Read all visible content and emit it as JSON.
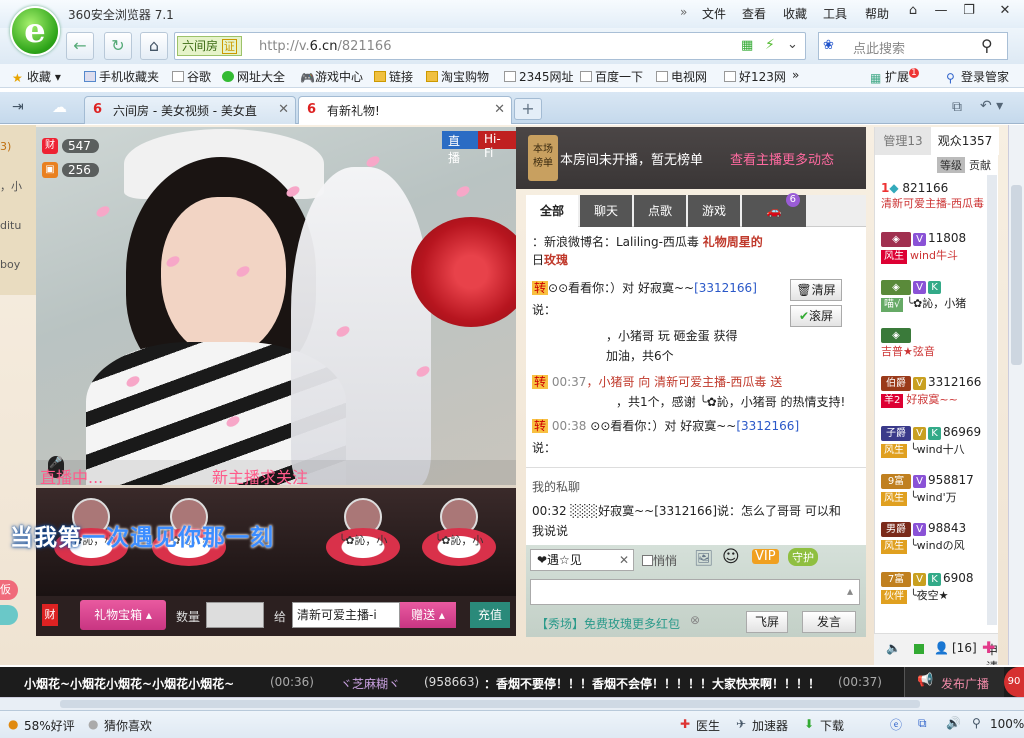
{
  "browser": {
    "title": "360安全浏览器 7.1",
    "menu": [
      "文件",
      "查看",
      "收藏",
      "工具",
      "帮助"
    ],
    "site_tag": "六间房",
    "cert_label": "证",
    "url_prefix": "http://v.",
    "url_domain": "6.cn",
    "url_path": "/821166",
    "search_placeholder": "点此搜索",
    "logo_letter": "e"
  },
  "bookmarks": {
    "items": [
      "收藏",
      "手机收藏夹",
      "谷歌",
      "网址大全",
      "游戏中心",
      "链接",
      "淘宝购物",
      "2345网址",
      "百度一下",
      "电视网",
      "好123网"
    ],
    "more": "»",
    "extend": "扩展",
    "extend_badge": "1",
    "login": "登录管家"
  },
  "tabs": [
    {
      "label": "六间房 - 美女视频 - 美女直",
      "active": false
    },
    {
      "label": "有新礼物!",
      "active": true
    }
  ],
  "video": {
    "live_label": "直播",
    "hifi_label": "Hi-Fi",
    "wealth_icon": "财",
    "wealth_value": "547",
    "gift_value": "256",
    "live_status": "直播中...",
    "new_host": "新主播求关注",
    "karaoke_pre": "当我第",
    "karaoke_hl": "一次遇见你那一刻",
    "gifts": [
      "╰✿訫，小",
      "╰✿訫，小",
      "╰✿訫，小",
      "╰✿訫，小"
    ]
  },
  "giftbar": {
    "wealth_icon": "财",
    "box_label": "礼物宝箱",
    "qty_label": "数量",
    "to_label": "给",
    "recipient": "清新可爱主播-i",
    "give_button": "赠送",
    "recharge_button": "充值"
  },
  "left_panel": {
    "lines": [
      "3)",
      "，小",
      "ditu",
      "boy"
    ],
    "bottom": [
      "仮"
    ]
  },
  "notice": {
    "badge_top": "本场",
    "badge_bottom": "榜单",
    "text": "本房间未开播，暂无榜单",
    "link": "查看主播更多动态"
  },
  "chat_tabs": [
    "全部",
    "聊天",
    "点歌",
    "游戏"
  ],
  "chat_tab_badge": "6",
  "chat": {
    "lines": [
      {
        "prefix": "",
        "user": "",
        "text": "：新浪微博名：Laliling-西瓜毒",
        "extra": "礼物周星的"
      },
      {
        "prefix": "日",
        "user": "",
        "text": "玫瑰",
        "extra": ""
      },
      {
        "prefix": "转",
        "user": "",
        "text": "⊙⊙看看你：）对 好寂寞~~",
        "extra": "[3312166]"
      },
      {
        "prefix": "说：",
        "user": "",
        "text": "",
        "extra": ""
      },
      {
        "prefix": "",
        "user": "",
        "text": "，小猪哥 玩 砸金蛋 获得",
        "extra": ""
      },
      {
        "prefix": "",
        "user": "",
        "text": "加油，共6个",
        "extra": ""
      },
      {
        "prefix": "转",
        "user": "00:37",
        "text": "，小猪哥 向 清新可爱主播-西瓜毒 送",
        "extra": ""
      },
      {
        "prefix": "",
        "user": "",
        "text": "，共1个，感谢 ╰✿訫，小猪哥 的热情支持!",
        "extra": ""
      },
      {
        "prefix": "转",
        "user": "00:38",
        "text": "⊙⊙看看你：）对 好寂寞~~",
        "extra": "[3312166]"
      },
      {
        "prefix": "说：",
        "user": "",
        "text": "",
        "extra": ""
      }
    ],
    "clear_btn": "清屏",
    "scroll_btn": "滚屏",
    "private_header": "我的私聊",
    "private_line": "00:32 ░░░好寂寞~~[3312166]说：怎么了哥哥 可以和",
    "private_line2": "我说说"
  },
  "input": {
    "target": "❤遇☆见",
    "whisper": "悄悄",
    "promo": "【秀场】免费玫瑰更多红包",
    "fly_button": "飞屏",
    "send_button": "发言"
  },
  "audience": {
    "manager_tab": "管理13",
    "viewer_tab": "观众1357",
    "level_btn": "等级",
    "contrib_btn": "贡献",
    "rows": [
      {
        "rank": "1",
        "id": "821166",
        "name": "清新可爱主播-西瓜毒",
        "badge": ""
      },
      {
        "rank": "",
        "id": "11808",
        "name": "wind牛斗",
        "badge": "风生"
      },
      {
        "rank": "",
        "id": "",
        "name": "╰✿訫，小猪",
        "badge": "喵√"
      },
      {
        "rank": "",
        "id": "",
        "name": "吉普★弦音",
        "badge": ""
      },
      {
        "rank": "伯爵",
        "id": "3312166",
        "name": "好寂寞~~",
        "badge": "羊2"
      },
      {
        "rank": "子爵",
        "id": "86969",
        "name": "╰wind十八",
        "badge": "风生"
      },
      {
        "rank": "9富",
        "id": "958817",
        "name": "╰wind'万",
        "badge": "风生"
      },
      {
        "rank": "男爵",
        "id": "98843",
        "name": "╰windの风",
        "badge": "风生"
      },
      {
        "rank": "7富",
        "id": "6908",
        "name": "╰夜空★",
        "badge": "伙伴"
      }
    ],
    "mic_count": "[16]",
    "apply": "申请",
    "notify_badge": "15"
  },
  "ticker": {
    "text1": "小烟花~小烟花小烟花~小烟花小烟花~",
    "time1": "(00:36)",
    "user2": "ヾ芝麻糊ヾ",
    "id2": "(958663)",
    "text2": "：香烟不要停！！！香烟不会停！！！！！大家快来啊！！！！",
    "time2": "(00:37)",
    "publish": "发布广播",
    "level_badge": "90"
  },
  "statusbar": {
    "rating": "58%好评",
    "guess": "猜你喜欢",
    "doctor": "医生",
    "accelerator": "加速器",
    "download": "下载",
    "zoom": "100%"
  },
  "colors": {
    "accent": "#2a6cc4",
    "brand_red": "#c02020",
    "live_pink": "#ff5a8a",
    "brand_green": "#2ca318"
  }
}
